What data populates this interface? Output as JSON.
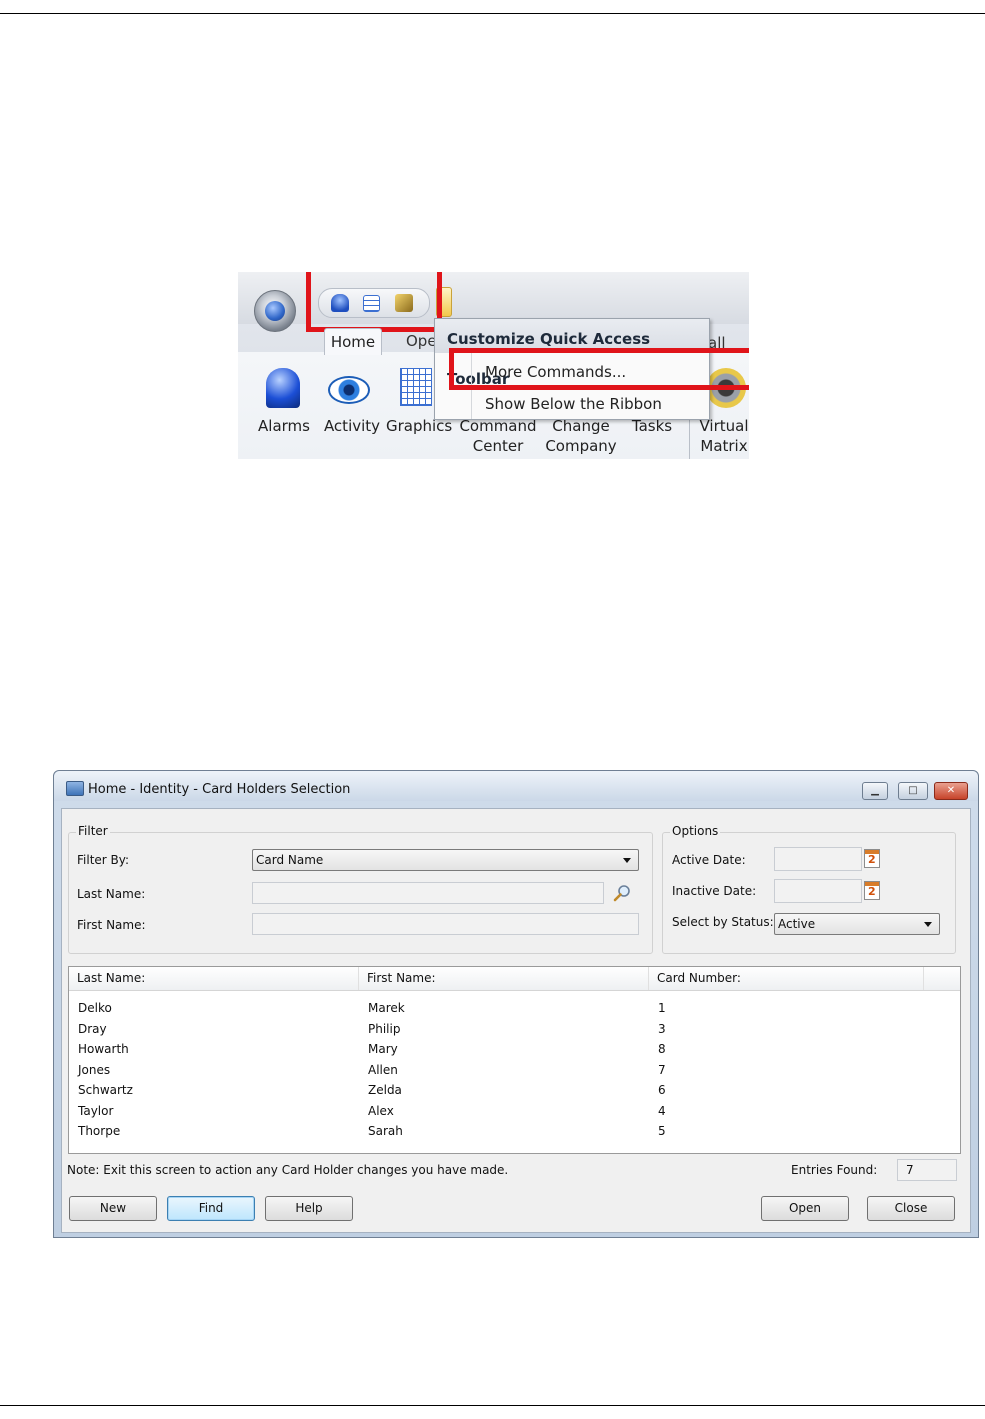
{
  "ribbon": {
    "tabs": [
      "Home",
      "Ope",
      "all"
    ],
    "menu": {
      "title": "Customize Quick Access Toolbar",
      "items": [
        "More Commands...",
        "Show Below the Ribbon"
      ]
    },
    "buttons": [
      {
        "line1": "Alarms",
        "line2": ""
      },
      {
        "line1": "Activity",
        "line2": ""
      },
      {
        "line1": "Graphics",
        "line2": ""
      },
      {
        "line1": "Command",
        "line2": "Center"
      },
      {
        "line1": "Change",
        "line2": "Company"
      },
      {
        "line1": "Tasks",
        "line2": ""
      },
      {
        "line1": "Virtual",
        "line2": "Matrix"
      }
    ],
    "highlight_color": "#e0141a"
  },
  "dialog": {
    "title": "Home - Identity - Card Holders Selection",
    "window_buttons": {
      "minimize": "▁",
      "maximize": "□",
      "close": "✕"
    },
    "filter": {
      "group_label": "Filter",
      "filter_by_label": "Filter By:",
      "filter_by_value": "Card Name",
      "last_name_label": "Last Name:",
      "last_name_value": "",
      "first_name_label": "First Name:",
      "first_name_value": ""
    },
    "options": {
      "group_label": "Options",
      "active_date_label": "Active Date:",
      "active_date_value": "",
      "inactive_date_label": "Inactive Date:",
      "inactive_date_value": "",
      "status_label": "Select by Status:",
      "status_value": "Active",
      "calendar_glyph": "2"
    },
    "list": {
      "columns": [
        "Last Name:",
        "First Name:",
        "Card Number:"
      ],
      "rows": [
        [
          "Delko",
          "Marek",
          "1"
        ],
        [
          "Dray",
          "Philip",
          "3"
        ],
        [
          "Howarth",
          "Mary",
          "8"
        ],
        [
          "Jones",
          "Allen",
          "7"
        ],
        [
          "Schwartz",
          "Zelda",
          "6"
        ],
        [
          "Taylor",
          "Alex",
          "4"
        ],
        [
          "Thorpe",
          "Sarah",
          "5"
        ]
      ]
    },
    "note": "Note: Exit this screen to action any Card Holder changes you have made.",
    "entries_label": "Entries Found:",
    "entries_value": "7",
    "buttons": {
      "new": "New",
      "find": "Find",
      "help": "Help",
      "open": "Open",
      "close": "Close"
    }
  }
}
